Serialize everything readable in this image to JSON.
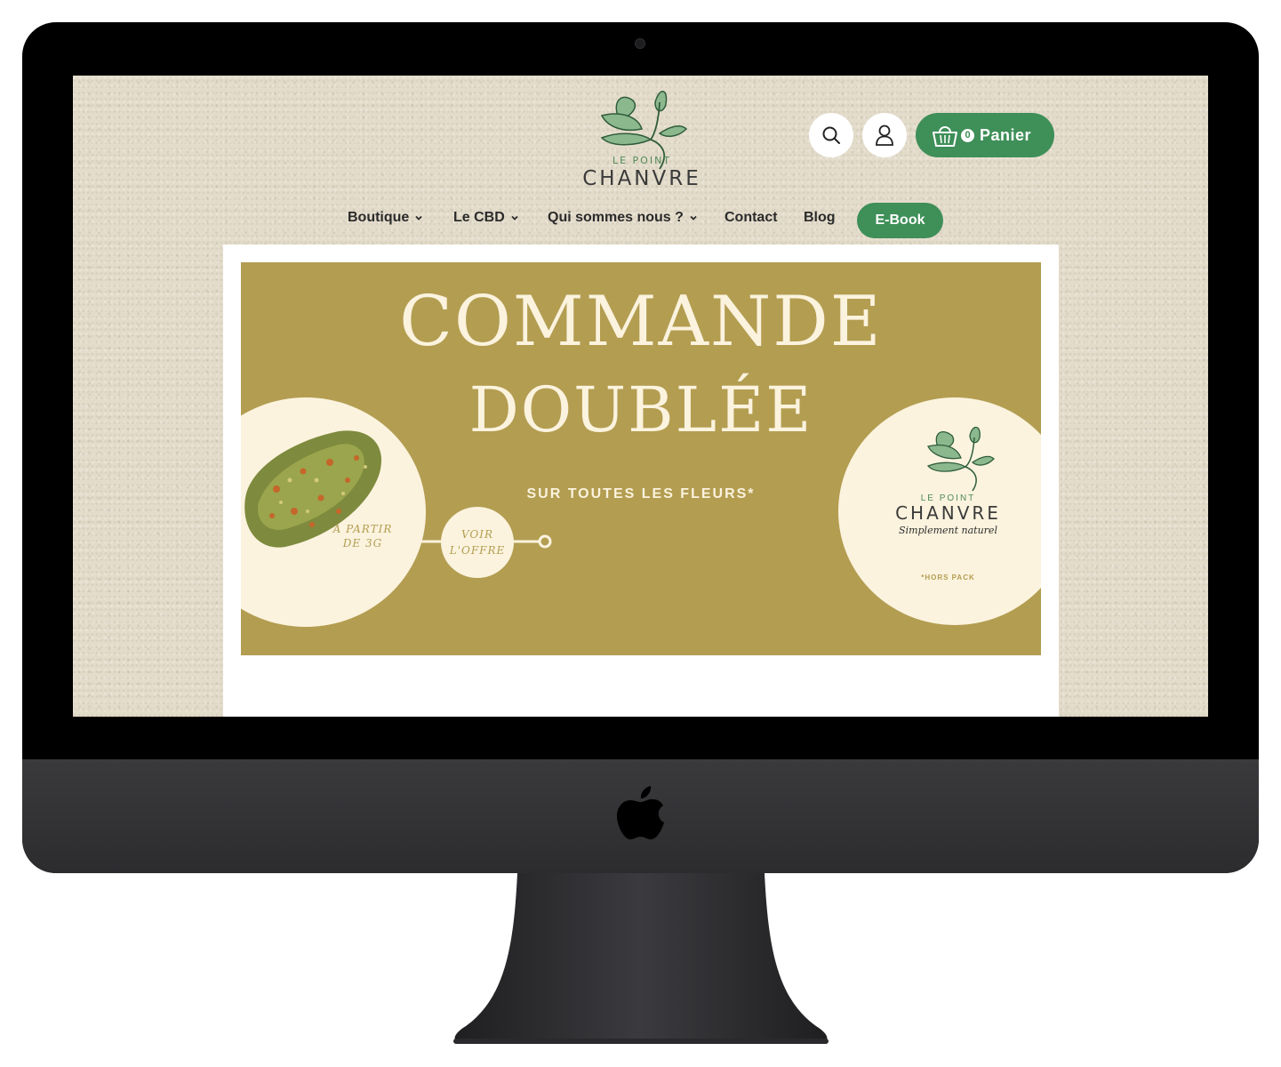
{
  "header": {
    "logo": {
      "small": "LE POINT",
      "big": "CHANVRE"
    },
    "cart": {
      "count": "0",
      "label": "Panier"
    }
  },
  "nav": {
    "items": [
      {
        "label": "Boutique",
        "has_dropdown": true
      },
      {
        "label": "Le CBD",
        "has_dropdown": true
      },
      {
        "label": "Qui sommes nous ?",
        "has_dropdown": true
      },
      {
        "label": "Contact",
        "has_dropdown": false
      },
      {
        "label": "Blog",
        "has_dropdown": false
      }
    ],
    "ebook_label": "E-Book"
  },
  "banner": {
    "headline_1": "COMMANDE",
    "headline_2": "DOUBLÉE",
    "subline": "SUR TOUTES LES FLEURS*",
    "price_note": "A PARTIR DE 3G",
    "offer": "VOIR L'OFFRE",
    "right_logo": {
      "small": "LE POINT",
      "big": "CHANVRE",
      "tagline": "Simplement naturel"
    },
    "footnote": "*HORS PACK"
  },
  "colors": {
    "brand_green": "#3e8f58",
    "banner_gold": "#b39d51",
    "cream": "#fbf3de",
    "paper": "#e4dccb"
  },
  "icons": [
    "search-icon",
    "user-icon",
    "basket-icon",
    "chevron-down-icon",
    "apple-logo-icon"
  ]
}
